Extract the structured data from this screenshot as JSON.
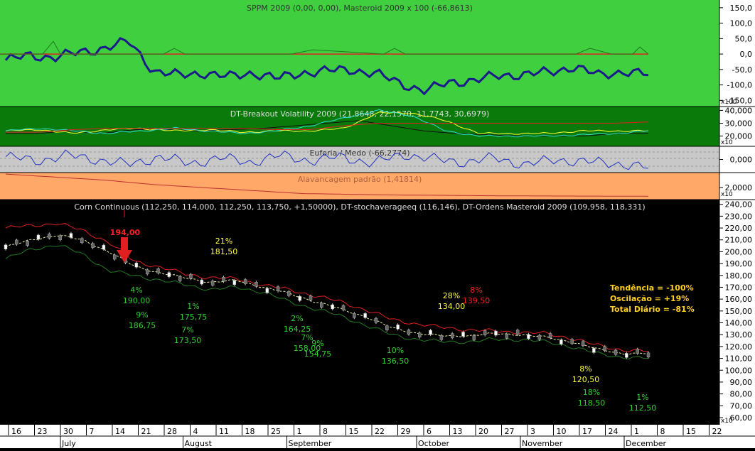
{
  "colors": {
    "pane1_bg": "#3fcf3f",
    "pane2_bg": "#0a7a0a",
    "pane3_bg": "#c8c8c8",
    "pane4_bg": "#ffa868",
    "price_bg": "#000000",
    "axis_bg": "#ffffff",
    "navy": "#1a1a8a",
    "red": "#e02020",
    "dark_green": "#1f7a1f",
    "yellow": "#ffff30",
    "cyan": "#30e0d0",
    "label_green": "#30d030",
    "label_yellow": "#ffff40",
    "label_red": "#ff2020"
  },
  "panes": {
    "p1": {
      "title": "SPPM 2009 (0,00, 0,00), Masteroid 2009 x 100 (-66,8613)",
      "ticks": [
        "150,0",
        "100,0",
        "50,0",
        "0,0",
        "-50,0",
        "-100,0",
        "-150,0"
      ],
      "tick_values": [
        150,
        100,
        50,
        0,
        -50,
        -100,
        -150
      ],
      "scale_label": "x100",
      "ylim": [
        -170,
        175
      ]
    },
    "p2": {
      "title": "DT-Breakout Volatility 2009 (21,8648, 22,1570, 11,7743, 30,6979)",
      "ticks": [
        "40,000",
        "30,000",
        "20,000"
      ],
      "tick_values": [
        40,
        30,
        20
      ],
      "scale_label": "x10",
      "ylim": [
        12,
        43
      ]
    },
    "p3": {
      "title": "Euforia / Medo (-66,2774)",
      "ticks": [
        "0,000"
      ],
      "tick_values": [
        0
      ],
      "ylim": [
        -100,
        100
      ]
    },
    "p4": {
      "title": "Alavancagem padrão (1,41814)",
      "ticks": [
        "2,0000"
      ],
      "tick_values": [
        2
      ],
      "scale_label": "x10",
      "ylim": [
        1.2,
        3.0
      ]
    },
    "price": {
      "title": "Corn Continuous (112,250, 114,000, 112,250, 113,750, +1,50000), DT-stochaverageeq (116,146), DT-Ordens Masteroid 2009 (109,958, 118,331)",
      "ticks": [
        "240,00",
        "230,00",
        "220,00",
        "210,00",
        "200,00",
        "190,00",
        "180,00",
        "170,00",
        "160,00",
        "150,00",
        "140,00",
        "130,00",
        "120,00",
        "110,00",
        "100,00",
        "90,00",
        "80,00",
        "70,00",
        "60,00"
      ],
      "tick_values": [
        240,
        230,
        220,
        210,
        200,
        190,
        180,
        170,
        160,
        150,
        140,
        130,
        120,
        110,
        100,
        90,
        80,
        70,
        60
      ],
      "scale_label": "x10",
      "ylim": [
        54,
        244
      ],
      "summary": [
        "Tendência = -100%",
        "Oscilação = +19%",
        "Total Diário = -81%"
      ]
    }
  },
  "xaxis": {
    "days": [
      "16",
      "23",
      "30",
      "7",
      "14",
      "21",
      "28",
      "4",
      "11",
      "18",
      "25",
      "1",
      "8",
      "15",
      "22",
      "29",
      "6",
      "13",
      "20",
      "27",
      "3",
      "10",
      "17",
      "24",
      "1",
      "8",
      "15",
      "22"
    ],
    "months": [
      "July",
      "August",
      "September",
      "October",
      "November",
      "December"
    ]
  },
  "chart_data": {
    "type": "line",
    "title": "Corn Continuous (112,250, 114,000, 112,250, 113,750, +1,50000), DT-stochaverageeq (116,146), DT-Ordens Masteroid 2009 (109,958, 118,331)",
    "x": [
      "16",
      "23",
      "30",
      "7",
      "14",
      "21",
      "28",
      "4",
      "11",
      "18",
      "25",
      "1",
      "8",
      "15",
      "22",
      "29",
      "6",
      "13",
      "20",
      "27",
      "3",
      "10",
      "17",
      "24",
      "1",
      "8",
      "15",
      "22"
    ],
    "series": [
      {
        "name": "DT-Ordens Masteroid 2009 upper",
        "values": [
          220,
          222,
          224,
          218,
          208,
          192,
          187,
          181,
          178,
          177,
          172,
          168,
          163,
          158,
          151,
          143,
          139,
          136,
          134,
          133,
          132,
          131,
          127,
          121,
          117,
          116
        ]
      },
      {
        "name": "DT-stochaverageeq",
        "values": [
          204,
          210,
          214,
          210,
          200,
          188,
          182,
          178,
          174,
          176,
          170,
          165,
          158,
          152,
          145,
          136,
          131,
          129,
          129,
          131,
          130,
          128,
          124,
          118,
          114,
          114
        ]
      },
      {
        "name": "DT-Ordens Masteroid 2009 lower",
        "values": [
          194,
          202,
          206,
          198,
          184,
          180,
          176,
          172,
          168,
          170,
          166,
          158,
          152,
          146,
          138,
          130,
          126,
          124,
          124,
          126,
          126,
          124,
          120,
          114,
          111,
          110
        ]
      },
      {
        "name": "Masteroid 2009 x 100",
        "values": [
          -20,
          -5,
          -10,
          5,
          20,
          40,
          -55,
          -70,
          -60,
          -75,
          -60,
          -80,
          -60,
          -55,
          -50,
          -65,
          -95,
          -120,
          -90,
          -85,
          -70,
          -65,
          -60,
          -40,
          -70,
          -55,
          -68
        ]
      },
      {
        "name": "Euforia / Medo",
        "values": [
          -66
        ]
      },
      {
        "name": "Alavancagem padrão",
        "values": [
          1.42
        ]
      }
    ],
    "annotations": [
      {
        "pct": "",
        "price": "194,00",
        "color": "red"
      },
      {
        "pct": "21%",
        "price": "181,50",
        "color": "yellow"
      },
      {
        "pct": "4%",
        "price": "190,00",
        "color": "green"
      },
      {
        "pct": "9%",
        "price": "186,75",
        "color": "green"
      },
      {
        "pct": "1%",
        "price": "175,75",
        "color": "green"
      },
      {
        "pct": "7%",
        "price": "173,50",
        "color": "green"
      },
      {
        "pct": "2%",
        "price": "164,25",
        "color": "green"
      },
      {
        "pct": "7%",
        "price": "158,00",
        "color": "green"
      },
      {
        "pct": "9%",
        "price": "154,75",
        "color": "green"
      },
      {
        "pct": "10%",
        "price": "136,50",
        "color": "green"
      },
      {
        "pct": "28%",
        "price": "134,00",
        "color": "yellow"
      },
      {
        "pct": "8%",
        "price": "139,50",
        "color": "red"
      },
      {
        "pct": "8%",
        "price": "120,50",
        "color": "yellow"
      },
      {
        "pct": "18%",
        "price": "118,50",
        "color": "green"
      },
      {
        "pct": "1%",
        "price": "112,50",
        "color": "green"
      }
    ]
  }
}
